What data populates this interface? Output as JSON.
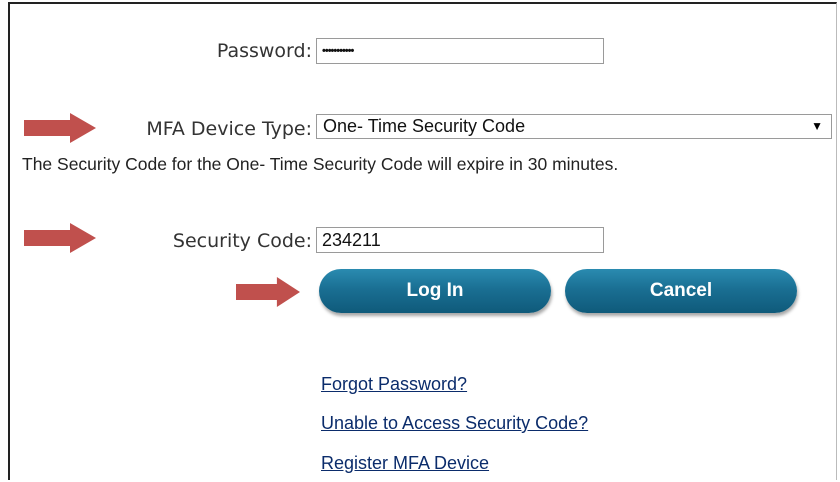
{
  "form": {
    "password_label": "Password:",
    "password_value": "•••••••••••",
    "mfa_label": "MFA Device Type:",
    "mfa_selected": "One- Time Security Code",
    "mfa_caret": "▼",
    "expiry_note": "The Security Code for the One- Time Security Code will expire in 30 minutes.",
    "security_code_label": "Security Code:",
    "security_code_value": "234211"
  },
  "buttons": {
    "login_label": "Log In",
    "cancel_label": "Cancel"
  },
  "links": {
    "forgot_password": "Forgot Password?",
    "unable_access": "Unable to Access Security Code?",
    "register_device": "Register MFA Device"
  },
  "icons": {
    "arrow": "arrow-right-icon"
  },
  "colors": {
    "arrow": "#c0504d",
    "button": "#1a6f93",
    "link": "#0b2c6b"
  }
}
